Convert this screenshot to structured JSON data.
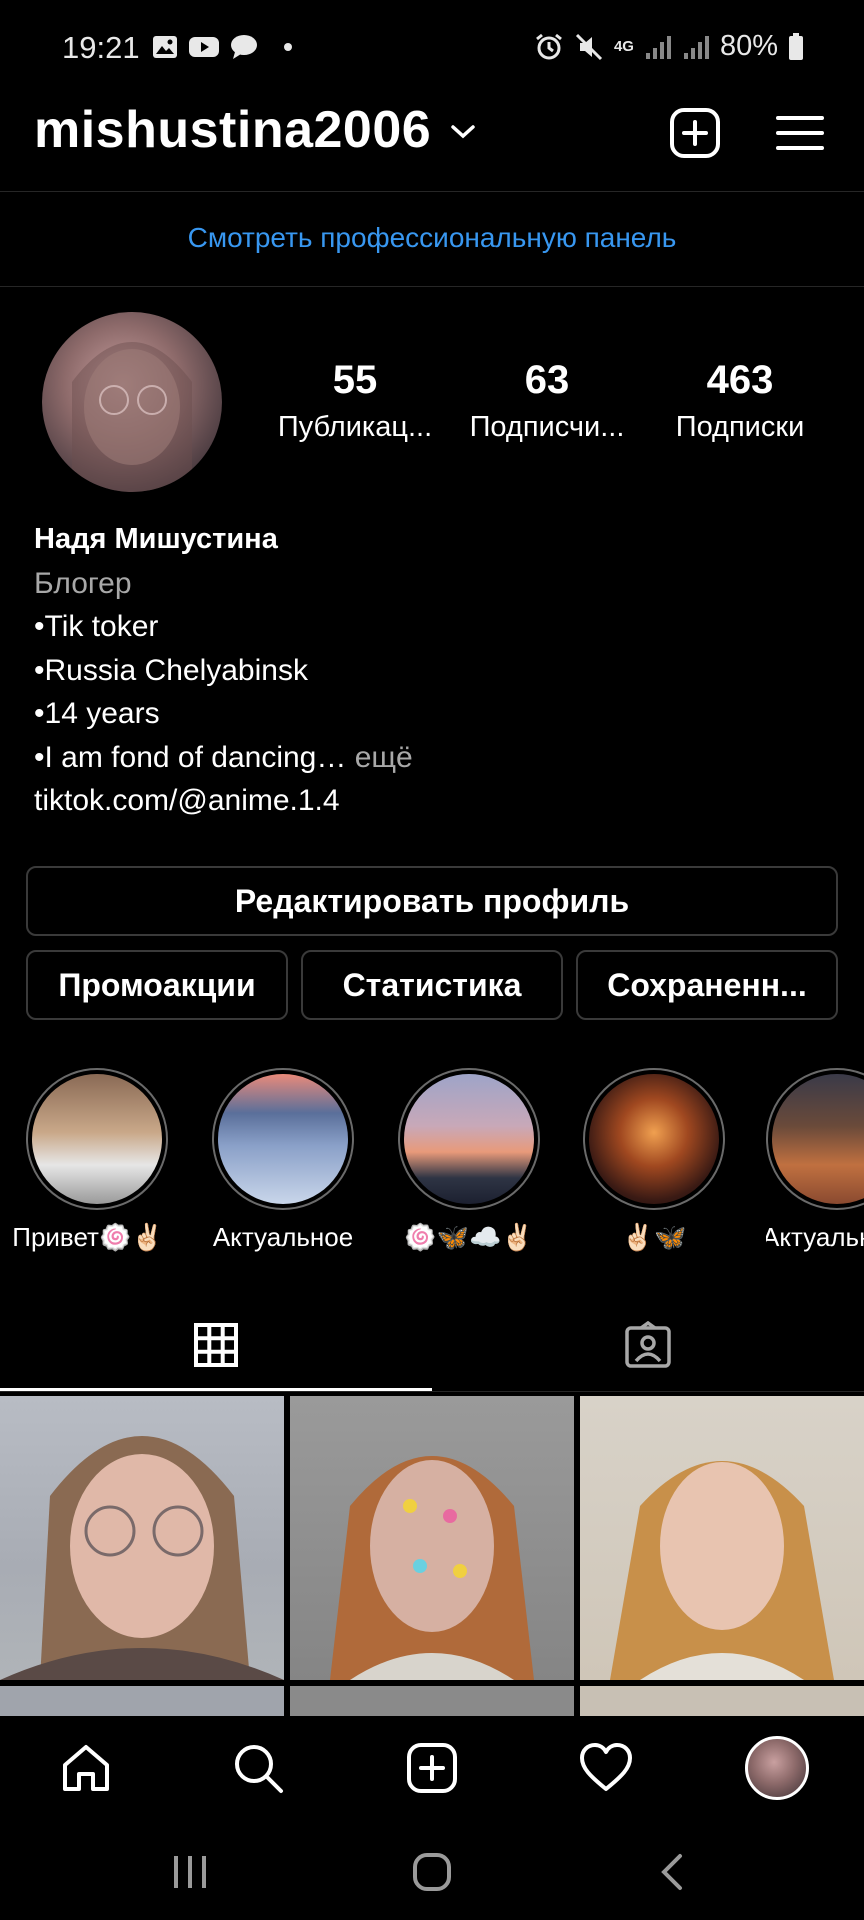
{
  "status_bar": {
    "time": "19:21",
    "battery": "80%",
    "network": "4G",
    "icons": [
      "gallery-icon",
      "youtube-icon",
      "chat-icon",
      "dot-icon",
      "alarm-icon",
      "mute-icon",
      "signal-icon",
      "signal-icon",
      "battery-icon"
    ]
  },
  "header": {
    "username": "mishustina2006",
    "icons": [
      "chevron-down-icon",
      "new-post-icon",
      "menu-icon"
    ]
  },
  "pro_dashboard": {
    "label": "Смотреть профессиональную панель"
  },
  "stats": [
    {
      "value": "55",
      "label": "Публикац..."
    },
    {
      "value": "63",
      "label": "Подписчи..."
    },
    {
      "value": "463",
      "label": "Подписки"
    }
  ],
  "bio": {
    "name": "Надя Мишустина",
    "category": "Блогер",
    "lines": [
      "•Tik toker",
      "•Russia Chelyabinsk",
      "•14 years",
      "•I am fond of dancing…"
    ],
    "more": " ещё",
    "link": "tiktok.com/@anime.1.4"
  },
  "buttons": {
    "edit_profile": "Редактировать профиль",
    "promotions": "Промоакции",
    "insights": "Статистика",
    "saved": "Сохраненн..."
  },
  "highlights": [
    {
      "label": "Привет🍥✌🏻"
    },
    {
      "label": "Актуальное"
    },
    {
      "label": "🍥🦋☁️✌🏻"
    },
    {
      "label": "✌🏻🦋"
    },
    {
      "label": "Актуальн"
    }
  ],
  "tabs": [
    {
      "icon": "grid-icon",
      "active": true
    },
    {
      "icon": "tagged-icon",
      "active": false
    }
  ],
  "bottom_nav": [
    "home-icon",
    "search-icon",
    "create-icon",
    "activity-icon",
    "profile-avatar"
  ],
  "colors": {
    "background": "#000000",
    "link": "#3897f0",
    "border": "#3a3a3a",
    "muted": "#a8a8a8"
  }
}
